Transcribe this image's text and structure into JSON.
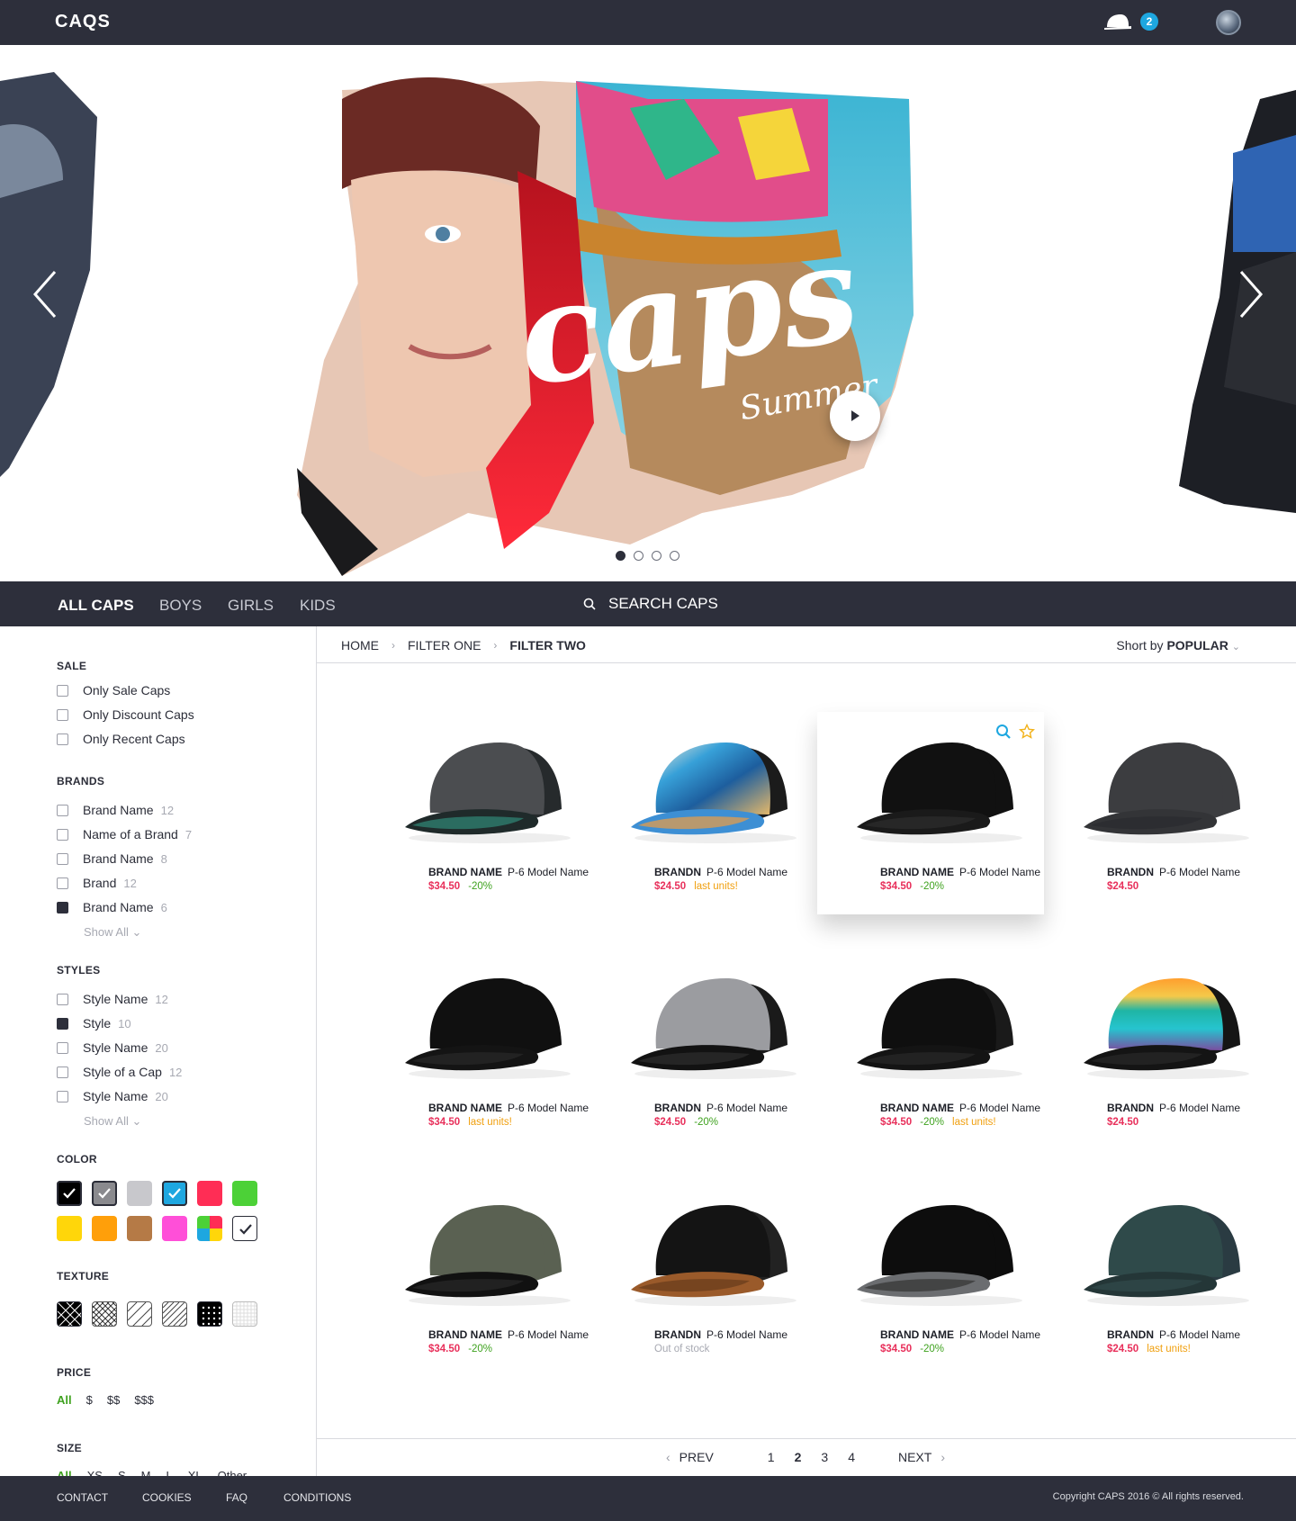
{
  "app": {
    "logo": "CAQS",
    "cart_count": "2",
    "cart_icon": "cap-icon",
    "avatar_icon": "user-avatar"
  },
  "hero": {
    "script_text": "caps",
    "sub_text": "Summer",
    "play_icon": "play-icon",
    "prev_icon": "chevron-left-icon",
    "next_icon": "chevron-right-icon",
    "slides": 4,
    "active_slide": 1
  },
  "nav": {
    "tabs": [
      "ALL CAPS",
      "BOYS",
      "GIRLS",
      "KIDS"
    ],
    "active": "ALL CAPS",
    "search_label": "SEARCH CAPS"
  },
  "filters": {
    "sale": {
      "title": "SALE",
      "options": [
        {
          "label": "Only Sale Caps",
          "checked": false
        },
        {
          "label": "Only Discount Caps",
          "checked": false
        },
        {
          "label": "Only Recent Caps",
          "checked": false
        }
      ]
    },
    "brands": {
      "title": "BRANDS",
      "show_all": "Show All",
      "options": [
        {
          "label": "Brand Name",
          "count": "12",
          "checked": false
        },
        {
          "label": "Name of a Brand",
          "count": "7",
          "checked": false
        },
        {
          "label": "Brand Name",
          "count": "8",
          "checked": false
        },
        {
          "label": "Brand",
          "count": "12",
          "checked": false
        },
        {
          "label": "Brand Name",
          "count": "6",
          "checked": true
        }
      ]
    },
    "styles": {
      "title": "STYLES",
      "show_all": "Show All",
      "options": [
        {
          "label": "Style Name",
          "count": "12",
          "checked": false
        },
        {
          "label": "Style",
          "count": "10",
          "checked": true
        },
        {
          "label": "Style Name",
          "count": "20",
          "checked": false
        },
        {
          "label": "Style of a Cap",
          "count": "12",
          "checked": false
        },
        {
          "label": "Style Name",
          "count": "20",
          "checked": false
        }
      ]
    },
    "color": {
      "title": "COLOR",
      "swatches": [
        {
          "color": "#000000",
          "checked": true
        },
        {
          "color": "#8a8a8e",
          "checked": true
        },
        {
          "color": "#c8c8cc",
          "checked": false
        },
        {
          "color": "#1ea7e0",
          "checked": true
        },
        {
          "color": "#ff2d55",
          "checked": false
        },
        {
          "color": "#4cd137",
          "checked": false
        },
        {
          "color": "#ffd60a",
          "checked": false
        },
        {
          "color": "#ff9f0a",
          "checked": false
        },
        {
          "color": "#b57a46",
          "checked": false
        },
        {
          "color": "#ff4fd8",
          "checked": false
        },
        {
          "color": "multicolor",
          "checked": false
        },
        {
          "color": "#ffffff",
          "checked": true
        }
      ]
    },
    "texture": {
      "title": "TEXTURE",
      "items": [
        "cross-hatch",
        "diamond-grid",
        "diagonal-lines",
        "dense-diagonal",
        "dots",
        "fine-grid"
      ]
    },
    "price": {
      "title": "PRICE",
      "options": [
        "All",
        "$",
        "$$",
        "$$$"
      ],
      "active": "All"
    },
    "size": {
      "title": "SIZE",
      "options": [
        "All",
        "XS",
        "S",
        "M",
        "L",
        "XL",
        "Other"
      ],
      "active": "All"
    }
  },
  "breadcrumb": {
    "items": [
      "HOME",
      "FILTER ONE",
      "FILTER TWO"
    ]
  },
  "sort": {
    "label": "Short by",
    "value": "POPULAR"
  },
  "products": [
    {
      "brand": "BRAND NAME",
      "model": "P-6 Model Name",
      "price": "$34.50",
      "discount": "-20%",
      "note": "",
      "cap": "grey-trucker"
    },
    {
      "brand": "BRANDN",
      "model": "P-6 Model Name",
      "price": "$24.50",
      "discount": "",
      "note": "last units!",
      "cap": "wave-snapback"
    },
    {
      "brand": "BRAND NAME",
      "model": "P-6 Model Name",
      "price": "$34.50",
      "discount": "-20%",
      "note": "",
      "cap": "black-snapback",
      "hover": true
    },
    {
      "brand": "BRANDN",
      "model": "P-6 Model Name",
      "price": "$24.50",
      "discount": "",
      "note": "",
      "cap": "dark-grey-patch"
    },
    {
      "brand": "BRAND NAME",
      "model": "P-6 Model Name",
      "price": "$34.50",
      "discount": "",
      "note": "last units!",
      "cap": "black-script"
    },
    {
      "brand": "BRANDN",
      "model": "P-6 Model Name",
      "price": "$24.50",
      "discount": "-20%",
      "note": "",
      "cap": "grey-black-trucker"
    },
    {
      "brand": "BRAND NAME",
      "model": "P-6 Model Name",
      "price": "$34.50",
      "discount": "-20%",
      "note": "last units!",
      "cap": "black-gold-trucker"
    },
    {
      "brand": "BRANDN",
      "model": "P-6 Model Name",
      "price": "$24.50",
      "discount": "",
      "note": "",
      "cap": "striped-trucker"
    },
    {
      "brand": "BRAND NAME",
      "model": "P-6 Model Name",
      "price": "$34.50",
      "discount": "-20%",
      "note": "",
      "cap": "olive-snapback"
    },
    {
      "brand": "BRANDN",
      "model": "P-6 Model Name",
      "price": "",
      "discount": "",
      "note": "Out of stock",
      "cap": "black-brown-trucker"
    },
    {
      "brand": "BRAND NAME",
      "model": "P-6 Model Name",
      "price": "$34.50",
      "discount": "-20%",
      "note": "",
      "cap": "black-element"
    },
    {
      "brand": "BRANDN",
      "model": "P-6 Model Name",
      "price": "$24.50",
      "discount": "",
      "note": "last units!",
      "cap": "teal-trucker"
    }
  ],
  "pagination": {
    "prev": "PREV",
    "next": "NEXT",
    "pages": [
      "1",
      "2",
      "3",
      "4"
    ],
    "current": "2"
  },
  "footer": {
    "links": [
      "CONTACT",
      "COOKIES",
      "FAQ",
      "CONDITIONS"
    ],
    "copyright": "Copyright CAPS 2016 ©  All rights reserved."
  }
}
